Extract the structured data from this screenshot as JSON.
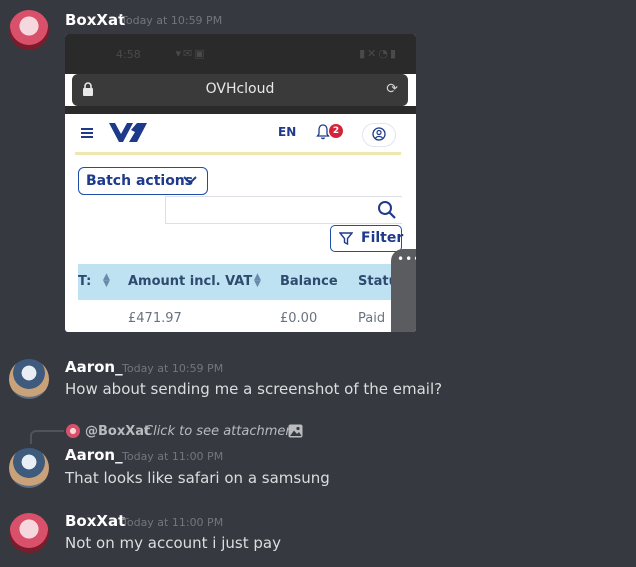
{
  "messages": [
    {
      "author": "BoxXat",
      "time": "Today at 10:59 PM",
      "text": ""
    },
    {
      "author": "Aaron_",
      "time": "Today at 10:59 PM",
      "text": "How about sending me a screenshot of the email?"
    },
    {
      "author": "Aaron_",
      "time": "Today at 11:00 PM",
      "text": "That looks like safari on a samsung"
    },
    {
      "author": "BoxXat",
      "time": "Today at 11:00 PM",
      "text": "Not on my account i just pay"
    }
  ],
  "reply": {
    "mention": "@BoxXat",
    "text": "Click to see attachment"
  },
  "attachment": {
    "status_time": "4:58",
    "url_title": "OVHcloud",
    "lang": "EN",
    "notification_count": "2",
    "batch_actions_label": "Batch actions",
    "filter_label": "Filter",
    "columns": [
      "T:",
      "Amount incl. VAT",
      "Balance",
      "Statu"
    ],
    "row": {
      "amount": "£471.97",
      "balance": "£0.00",
      "status": "Paid"
    }
  },
  "colors": {
    "background": "#36393f",
    "username": "#ffffff",
    "timestamp": "#72767d",
    "ovh_blue": "#1e3a8a",
    "table_header": "#bfe2f2"
  }
}
